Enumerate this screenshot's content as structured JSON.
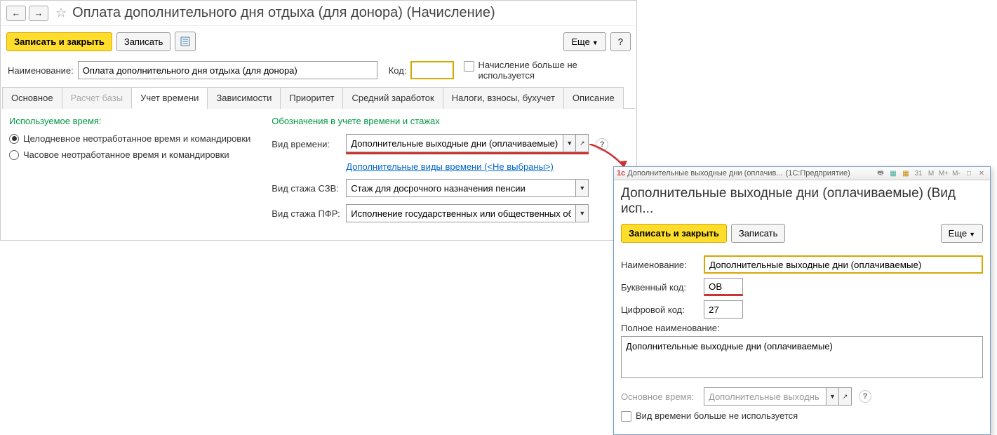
{
  "main": {
    "title": "Оплата дополнительного дня отдыха (для донора) (Начисление)",
    "toolbar": {
      "save_close": "Записать и закрыть",
      "save": "Записать",
      "more": "Еще",
      "help": "?"
    },
    "name_label": "Наименование:",
    "name_value": "Оплата дополнительного дня отдыха (для донора)",
    "code_label": "Код:",
    "code_value": "",
    "not_used_label": "Начисление больше не используется",
    "tabs": [
      "Основное",
      "Расчет базы",
      "Учет времени",
      "Зависимости",
      "Приоритет",
      "Средний заработок",
      "Налоги, взносы, бухучет",
      "Описание"
    ],
    "active_tab": 2,
    "time_group_label": "Используемое время:",
    "radio1": "Целодневное неотработанное время и командировки",
    "radio2": "Часовое неотработанное время и командировки",
    "marks_label": "Обозначения в учете времени и стажах",
    "time_type_label": "Вид времени:",
    "time_type_value": "Дополнительные выходные дни (оплачиваемые)",
    "extra_types_link": "Дополнительные виды времени (<Не выбраны>)",
    "szv_label": "Вид стажа СЗВ:",
    "szv_value": "Стаж для досрочного назначения пенсии",
    "pfr_label": "Вид стажа ПФР:",
    "pfr_value": "Исполнение государственных или общественных обяза"
  },
  "popup": {
    "titlebar_left": "Дополнительные выходные дни (оплачив...",
    "titlebar_right": "(1С:Предприятие)",
    "header": "Дополнительные выходные дни (оплачиваемые) (Вид исп...",
    "save_close": "Записать и закрыть",
    "save": "Записать",
    "more": "Еще",
    "name_label": "Наименование:",
    "name_value": "Дополнительные выходные дни (оплачиваемые)",
    "letter_label": "Буквенный код:",
    "letter_value": "ОВ",
    "digit_label": "Цифровой код:",
    "digit_value": "27",
    "full_label": "Полное наименование:",
    "full_value": "Дополнительные выходные дни (оплачиваемые)",
    "base_time_label": "Основное время:",
    "base_time_value": "Дополнительные выходнь",
    "not_used": "Вид времени больше не используется"
  }
}
